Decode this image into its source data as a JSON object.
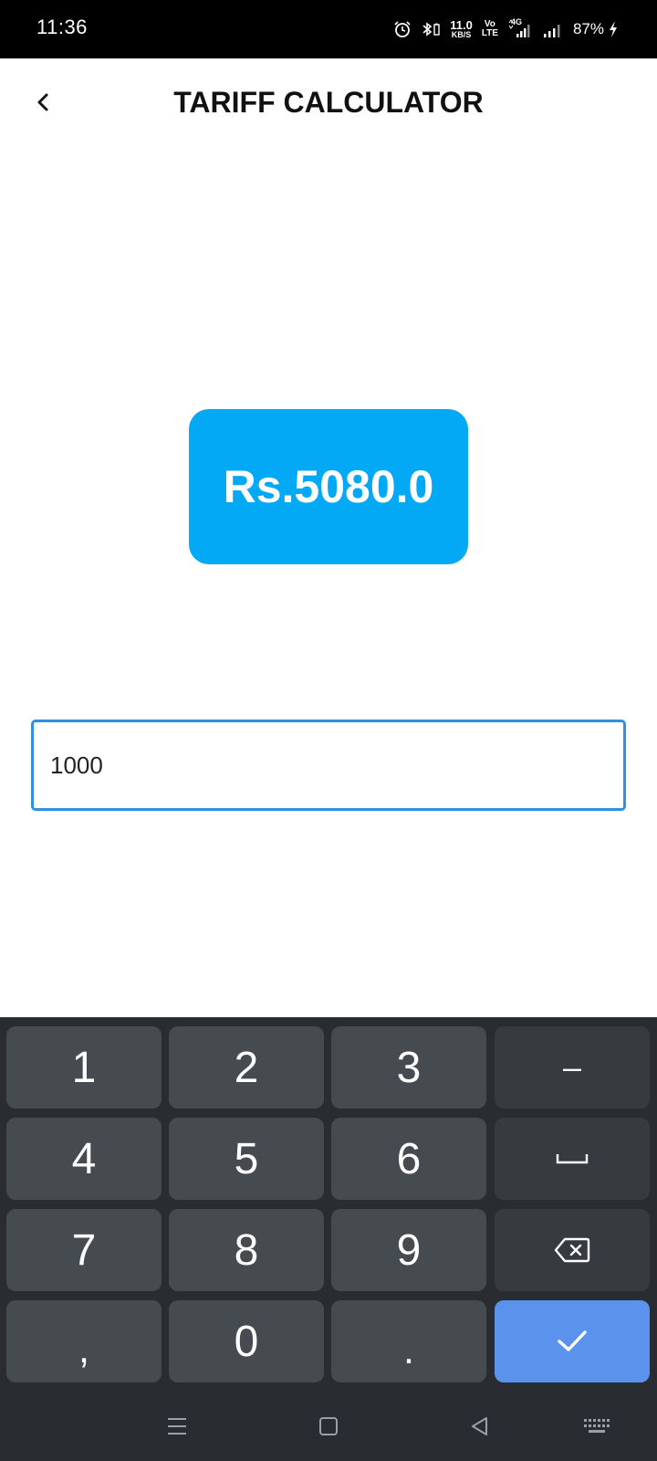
{
  "status_bar": {
    "time": "11:36",
    "net_speed_value": "11.0",
    "net_speed_unit": "KB/S",
    "volte_top": "Vo",
    "volte_bottom": "LTE",
    "network_type": "4G",
    "battery": "87%"
  },
  "header": {
    "title": "TARIFF CALCULATOR"
  },
  "result": {
    "amount": "Rs.5080.0"
  },
  "input": {
    "value": "1000"
  },
  "keyboard": {
    "keys": [
      "1",
      "2",
      "3",
      "–",
      "4",
      "5",
      "6",
      "␣",
      "7",
      "8",
      "9",
      "⌫",
      ",",
      "0",
      ".",
      "✓"
    ],
    "done_color": "#5b93ec"
  },
  "colors": {
    "result_bg": "#03a9f4",
    "input_border": "#2f8fe0"
  }
}
